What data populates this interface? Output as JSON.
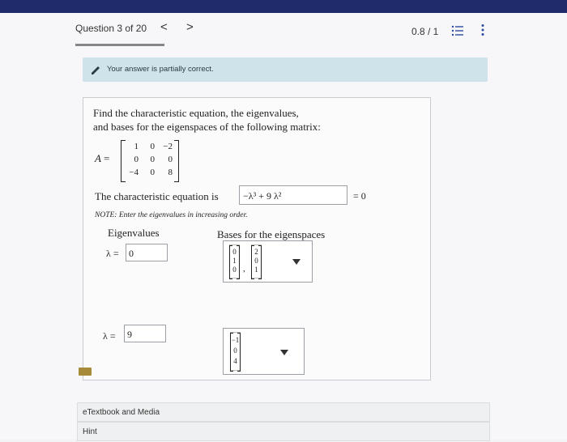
{
  "header": {
    "question_label": "Question 3 of 20",
    "prev_glyph": "<",
    "next_glyph": ">",
    "score": "0.8 / 1"
  },
  "banner": {
    "text": "Your answer is partially correct."
  },
  "question": {
    "prompt_line1": "Find the characteristic equation, the eigenvalues,",
    "prompt_line2": "and bases for the eigenspaces of the following matrix:",
    "matrix_name": "A",
    "matrix": [
      [
        "1",
        "0",
        "−2"
      ],
      [
        "0",
        "0",
        "0"
      ],
      [
        "−4",
        "0",
        "8"
      ]
    ],
    "char_label": "The characteristic equation is",
    "char_value": "−λ³ + 9 λ²",
    "equals_zero": "= 0",
    "note": "NOTE: Enter the eigenvalues in increasing order.",
    "col_eigenvalues": "Eigenvalues",
    "col_bases": "Bases for the eigenspaces",
    "lambda_label": "λ =",
    "eigen1": {
      "value": "0",
      "vectors": [
        [
          "0",
          "1",
          "0"
        ],
        [
          "2",
          "0",
          "1"
        ]
      ]
    },
    "eigen2": {
      "value": "9",
      "vectors": [
        [
          "−1",
          "0",
          "4"
        ]
      ]
    }
  },
  "links": {
    "etextbook": "eTextbook and Media",
    "hint": "Hint"
  },
  "colors": {
    "top_bar": "#1f2b6b",
    "banner_bg": "#cfe3ea",
    "keypad_icon": "#a78a3a"
  }
}
